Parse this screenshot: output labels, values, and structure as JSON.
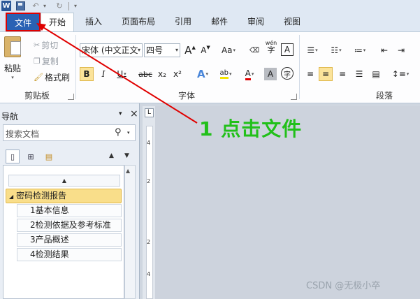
{
  "quick_access": {
    "app_icon": "W"
  },
  "tabs": [
    "文件",
    "开始",
    "插入",
    "页面布局",
    "引用",
    "邮件",
    "审阅",
    "视图"
  ],
  "ribbon": {
    "clipboard": {
      "paste": "粘贴",
      "cut": "剪切",
      "copy": "复制",
      "format_painter": "格式刷",
      "label": "剪贴板"
    },
    "font": {
      "font_name": "宋体 (中文正文",
      "font_size": "四号",
      "bold": "B",
      "italic": "I",
      "underline": "U",
      "strike": "abc",
      "subscript": "x₂",
      "superscript": "x²",
      "grow": "A",
      "shrink": "A",
      "change_case": "Aa",
      "wen": "wén",
      "char_border": "A",
      "text_effect": "A",
      "highlight": "ab",
      "font_color": "A",
      "char_shading": "A",
      "enclose": "字",
      "label": "字体"
    },
    "paragraph": {
      "label": "段落"
    }
  },
  "nav": {
    "title": "导航",
    "search_placeholder": "搜索文档",
    "heading": "密码检测报告",
    "children": [
      "1基本信息",
      "2检测依据及参考标准",
      "3产品概述",
      "4检测结果"
    ]
  },
  "ruler": {
    "numbers": [
      "4",
      "2",
      "2",
      "4"
    ]
  },
  "annotation": {
    "text": "1 点击文件"
  },
  "watermark": "CSDN @无极小卒",
  "colors": {
    "file_tab": "#2a62b4",
    "highlight_box": "#e00000",
    "annotation": "#22c01a",
    "heading_bg": "#f9de8a"
  }
}
